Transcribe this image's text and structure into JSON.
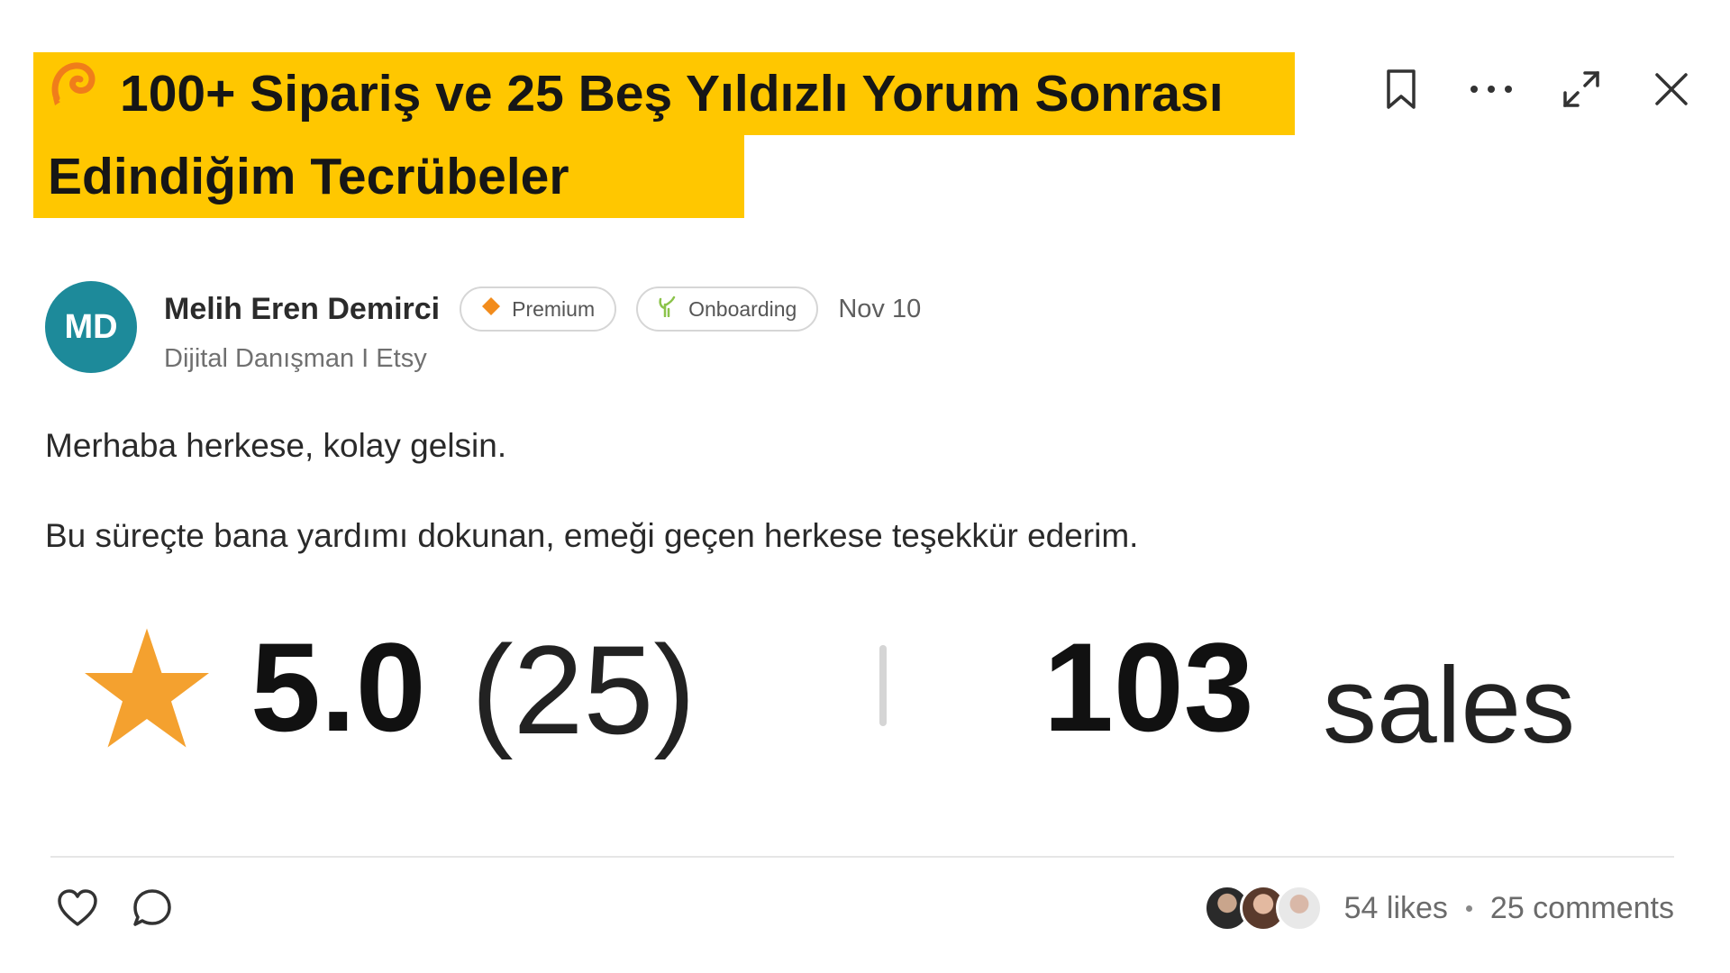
{
  "post": {
    "title_line1": "100+ Sipariş ve 25 Beş Yıldızlı Yorum Sonrası",
    "title_line2": "Edindiğim Tecrübeler",
    "title_emoji_icon": "swirl-emoji-icon",
    "title_highlight_color": "#ffc700"
  },
  "actions": {
    "bookmark_icon": "bookmark-icon",
    "more_icon": "more-dots-icon",
    "expand_icon": "expand-icon",
    "close_icon": "close-icon"
  },
  "author": {
    "initials": "MD",
    "avatar_color": "#1d8a9a",
    "name": "Melih Eren Demirci",
    "subtitle": "Dijital Danışman I Etsy",
    "badges": [
      {
        "label": "Premium",
        "icon": "diamond-icon",
        "color": "#f28c1c"
      },
      {
        "label": "Onboarding",
        "icon": "sprout-icon",
        "color": "#8bc34a"
      }
    ],
    "date": "Nov 10"
  },
  "body": {
    "paragraph1": "Merhaba herkese, kolay gelsin.",
    "paragraph2": "Bu süreçte bana yardımı dokunan, emeği geçen herkese teşekkür ederim."
  },
  "rating_image": {
    "star_icon": "star-icon",
    "star_color": "#f4a12f",
    "score": "5.0",
    "review_count": "(25)",
    "sales_number": "103",
    "sales_label": "sales"
  },
  "footer": {
    "like_icon": "heart-icon",
    "comment_icon": "comment-icon",
    "likers": [
      "liker-avatar-1",
      "liker-avatar-2",
      "liker-avatar-3"
    ],
    "likes_text": "54 likes",
    "comments_text": "25 comments"
  }
}
